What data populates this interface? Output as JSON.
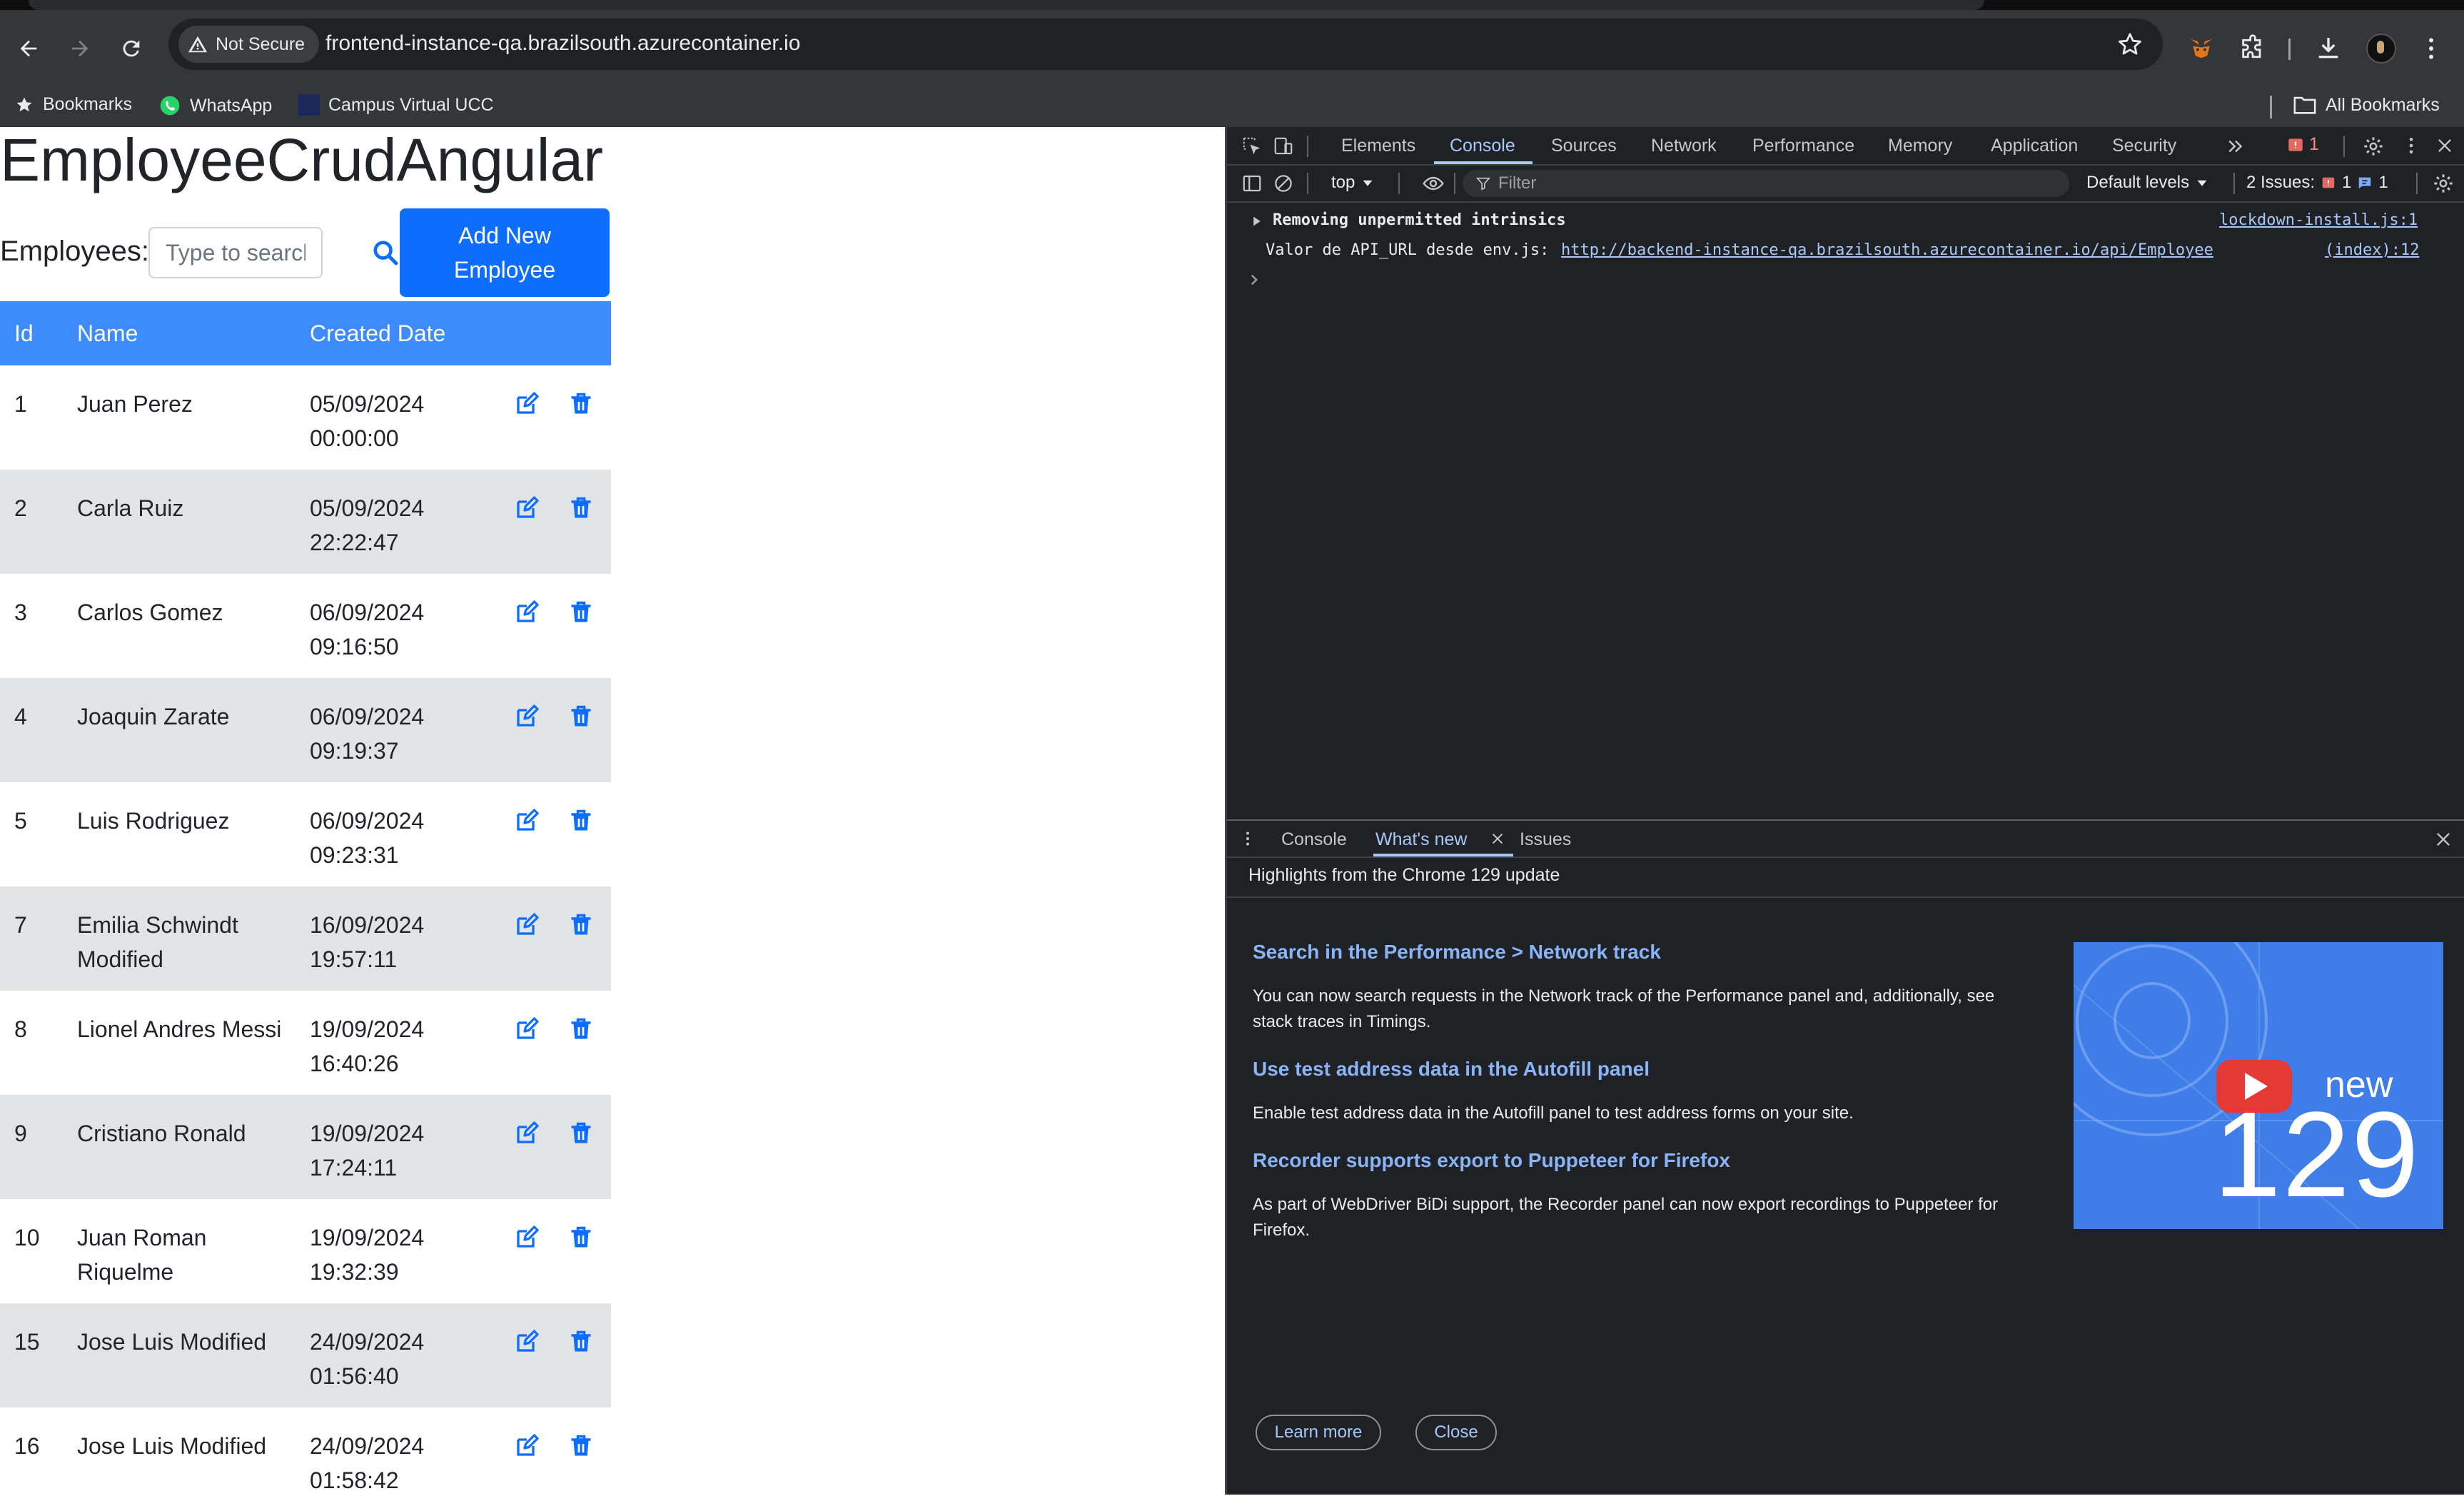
{
  "browser": {
    "security_label": "Not Secure",
    "url": "frontend-instance-qa.brazilsouth.azurecontainer.io",
    "bookmarks": [
      {
        "label": "Bookmarks",
        "icon": "star-icon"
      },
      {
        "label": "WhatsApp",
        "icon": "whatsapp-icon"
      },
      {
        "label": "Campus Virtual UCC",
        "icon": "ucc-icon"
      }
    ],
    "all_bookmarks_label": "All Bookmarks"
  },
  "app": {
    "title": "EmployeeCrudAngular",
    "employees_label": "Employees:",
    "search_placeholder": "Type to search..",
    "add_button_label": "Add New Employee",
    "table": {
      "headers": [
        "Id",
        "Name",
        "Created Date"
      ],
      "rows": [
        {
          "id": "1",
          "name": "Juan Perez",
          "date": "05/09/2024",
          "time": "00:00:00"
        },
        {
          "id": "2",
          "name": "Carla Ruiz",
          "date": "05/09/2024",
          "time": "22:22:47"
        },
        {
          "id": "3",
          "name": "Carlos Gomez",
          "date": "06/09/2024",
          "time": "09:16:50"
        },
        {
          "id": "4",
          "name": "Joaquin Zarate",
          "date": "06/09/2024",
          "time": "09:19:37"
        },
        {
          "id": "5",
          "name": "Luis Rodriguez",
          "date": "06/09/2024",
          "time": "09:23:31"
        },
        {
          "id": "7",
          "name": "Emilia Schwindt Modified",
          "date": "16/09/2024",
          "time": "19:57:11"
        },
        {
          "id": "8",
          "name": "Lionel Andres Messi",
          "date": "19/09/2024",
          "time": "16:40:26"
        },
        {
          "id": "9",
          "name": "Cristiano Ronald",
          "date": "19/09/2024",
          "time": "17:24:11"
        },
        {
          "id": "10",
          "name": "Juan Roman Riquelme",
          "date": "19/09/2024",
          "time": "19:32:39"
        },
        {
          "id": "15",
          "name": "Jose Luis Modified",
          "date": "24/09/2024",
          "time": "01:56:40"
        },
        {
          "id": "16",
          "name": "Jose Luis Modified",
          "date": "24/09/2024",
          "time": "01:58:42"
        }
      ]
    }
  },
  "devtools": {
    "tabs": [
      "Elements",
      "Console",
      "Sources",
      "Network",
      "Performance",
      "Memory",
      "Application",
      "Security"
    ],
    "active_tab": "Console",
    "error_count": "1",
    "context": "top",
    "filter_placeholder": "Filter",
    "levels": "Default levels",
    "issues_label": "2 Issues:",
    "issues_errors": "1",
    "issues_info": "1",
    "console": [
      {
        "text": "Removing unpermitted intrinsics",
        "source": "lockdown-install.js:1"
      },
      {
        "text": "Valor de API_URL desde env.js:",
        "link": "http://backend-instance-qa.brazilsouth.azurecontainer.io/api/Employee",
        "source": "(index):12"
      }
    ],
    "drawer": {
      "tabs": [
        "Console",
        "What's new",
        "Issues"
      ],
      "active_tab": "What's new",
      "subtitle": "Highlights from the Chrome 129 update",
      "items": [
        {
          "title": "Search in the Performance > Network track",
          "body": "You can now search requests in the Network track of the Performance panel and, additionally, see stack traces in Timings."
        },
        {
          "title": "Use test address data in the Autofill panel",
          "body": "Enable test address data in the Autofill panel to test address forms on your site."
        },
        {
          "title": "Recorder supports export to Puppeteer for Firefox",
          "body": "As part of WebDriver BiDi support, the Recorder panel can now export recordings to Puppeteer for Firefox."
        }
      ],
      "learn_more": "Learn more",
      "close": "Close",
      "image_word": "new",
      "image_number": "129"
    }
  },
  "colors": {
    "primary": "#0d6efd",
    "table_header": "#3d8bfd",
    "stripe": "#e2e3e5",
    "devtools_bg": "#202124",
    "devtools_link": "#8ab4f8"
  }
}
